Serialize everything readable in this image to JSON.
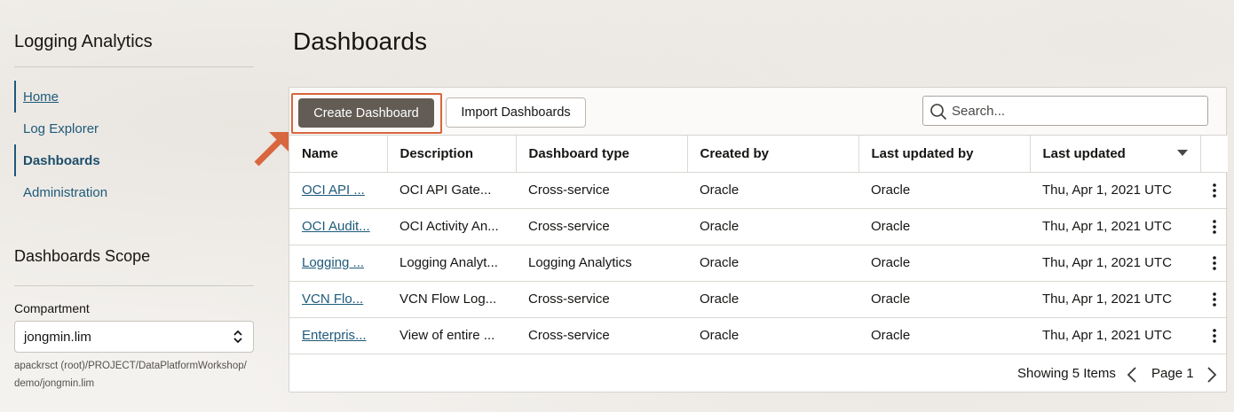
{
  "sidebar": {
    "app_title": "Logging Analytics",
    "nav": [
      {
        "label": "Home"
      },
      {
        "label": "Log Explorer"
      },
      {
        "label": "Dashboards"
      },
      {
        "label": "Administration"
      }
    ],
    "scope_title": "Dashboards Scope",
    "compartment_label": "Compartment",
    "compartment_value": "jongmin.lim",
    "compartment_path": "apackrsct (root)/PROJECT/DataPlatformWorkshop/\ndemo/jongmin.lim"
  },
  "main": {
    "title": "Dashboards",
    "toolbar": {
      "create_label": "Create Dashboard",
      "import_label": "Import Dashboards",
      "search_placeholder": "Search..."
    },
    "table": {
      "headers": [
        "Name",
        "Description",
        "Dashboard type",
        "Created by",
        "Last updated by",
        "Last updated"
      ],
      "rows": [
        [
          "OCI API ...",
          "OCI API Gate...",
          "Cross-service",
          "Oracle",
          "Oracle",
          "Thu, Apr 1, 2021 UTC"
        ],
        [
          "OCI Audit...",
          "OCI Activity An...",
          "Cross-service",
          "Oracle",
          "Oracle",
          "Thu, Apr 1, 2021 UTC"
        ],
        [
          "Logging ...",
          "Logging Analyt...",
          "Logging Analytics",
          "Oracle",
          "Oracle",
          "Thu, Apr 1, 2021 UTC"
        ],
        [
          "VCN Flo...",
          "VCN Flow Log...",
          "Cross-service",
          "Oracle",
          "Oracle",
          "Thu, Apr 1, 2021 UTC"
        ],
        [
          "Enterpris...",
          "View of entire ...",
          "Cross-service",
          "Oracle",
          "Oracle",
          "Thu, Apr 1, 2021 UTC"
        ]
      ]
    },
    "footer": {
      "showing": "Showing 5 Items",
      "page": "Page 1"
    }
  },
  "colors": {
    "accent_link": "#1e5a7a",
    "primary_button": "#625c55",
    "highlight": "#d8663f"
  },
  "icons": [
    "search-icon",
    "chevron-updown-icon",
    "sort-desc-icon",
    "kebab-menu-icon",
    "chevron-left-icon",
    "chevron-right-icon",
    "annotation-arrow-icon"
  ]
}
